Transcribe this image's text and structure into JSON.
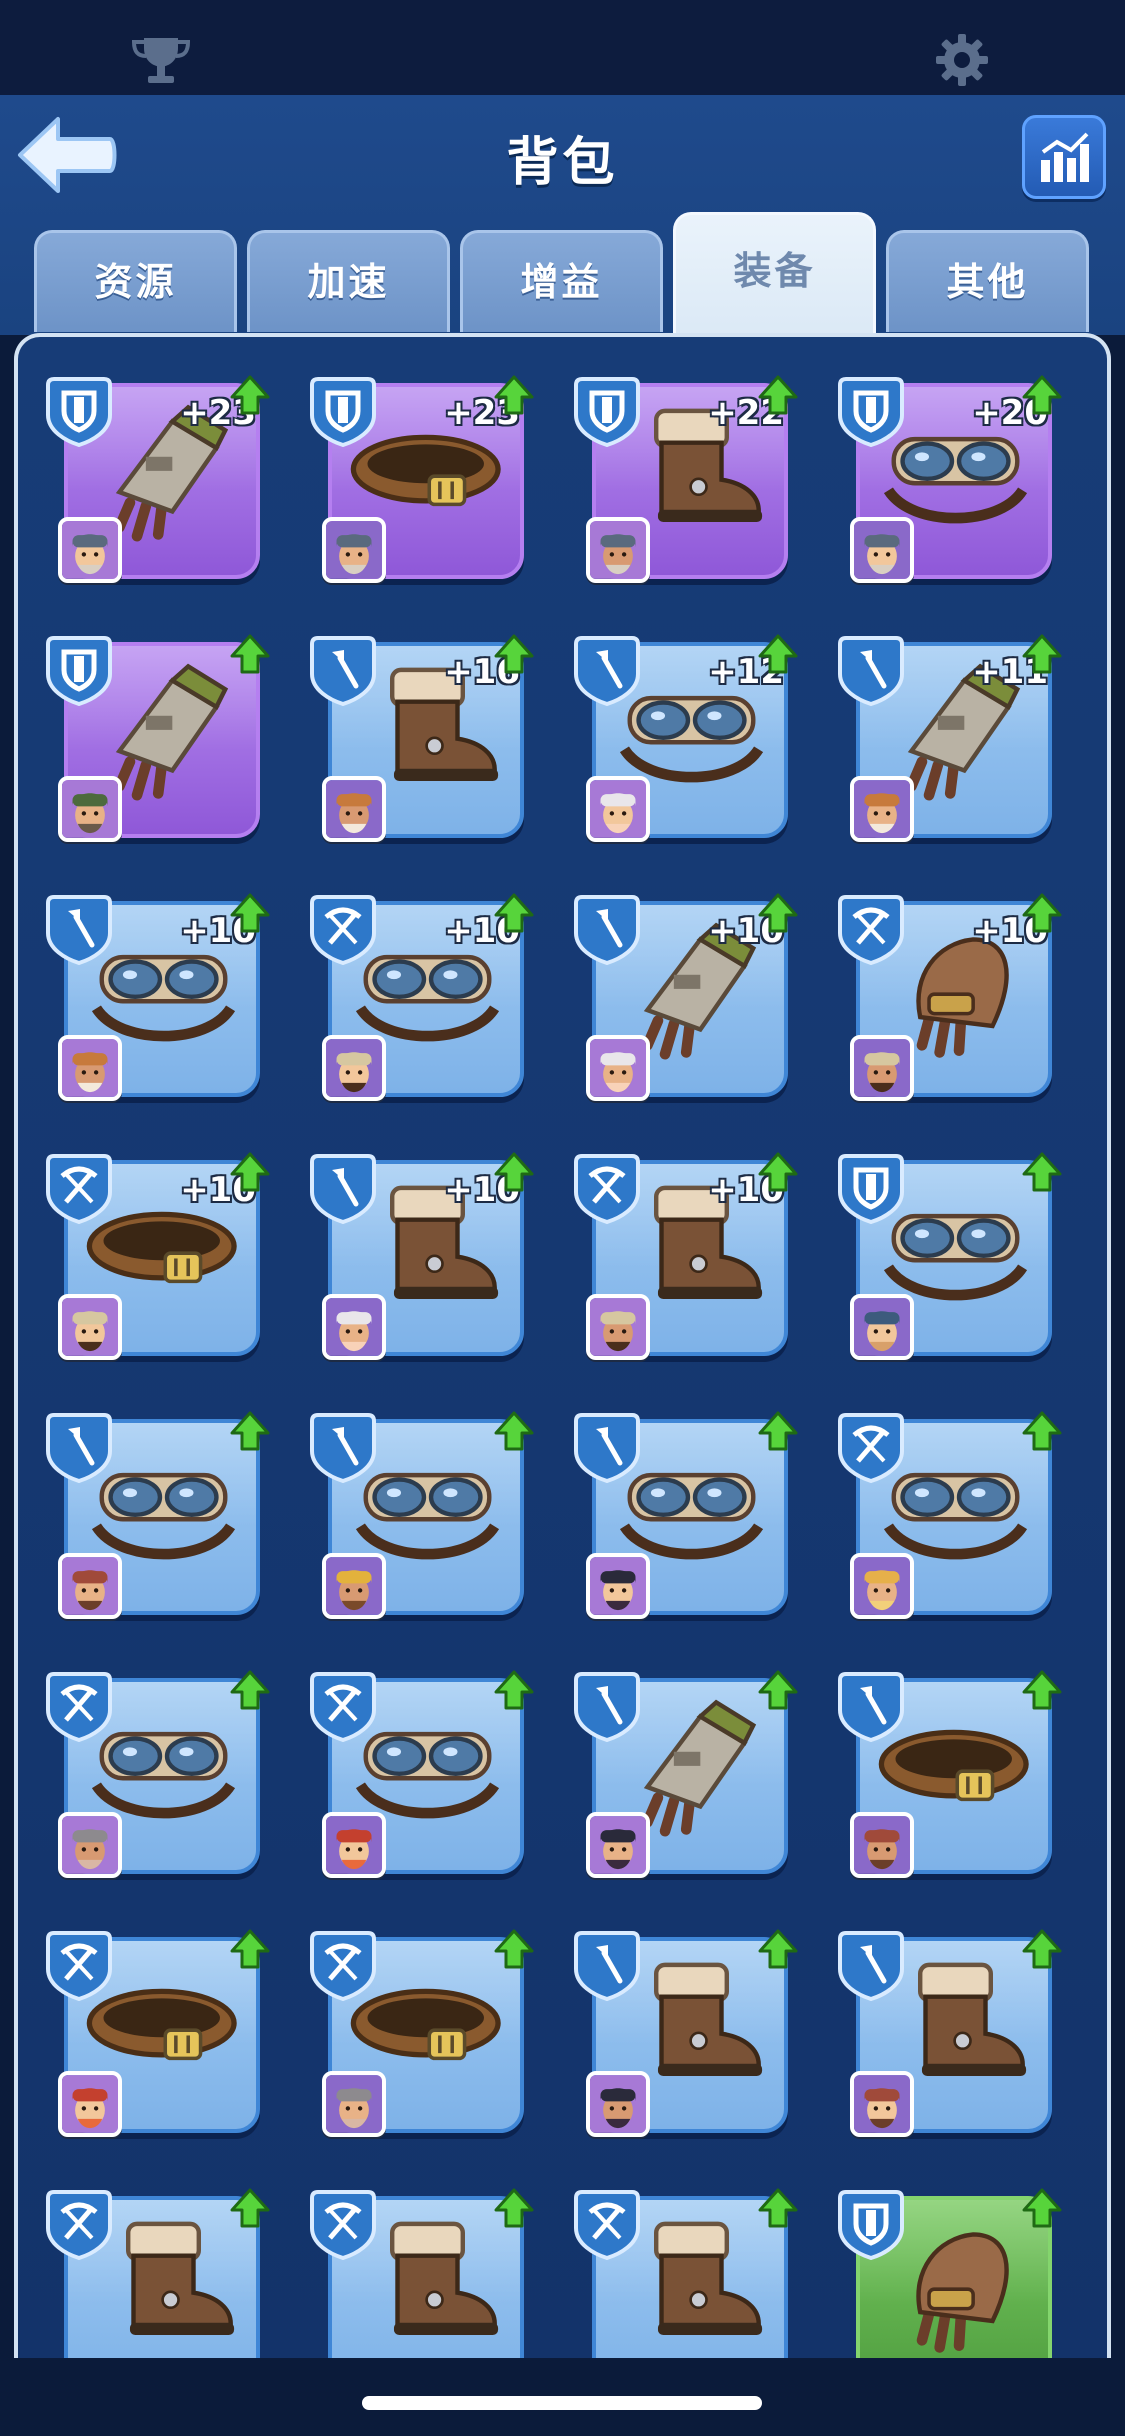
{
  "header": {
    "title": "背包"
  },
  "tabs": [
    {
      "label": "资源",
      "active": false
    },
    {
      "label": "加速",
      "active": false
    },
    {
      "label": "增益",
      "active": false
    },
    {
      "label": "装备",
      "active": true
    },
    {
      "label": "其他",
      "active": false
    }
  ],
  "icons": {
    "top_left": "trophy-icon",
    "top_right": "gear-icon",
    "back": "back-arrow-icon",
    "stats": "bar-chart-icon"
  },
  "colors": {
    "rarity_epic": "#9a63de",
    "rarity_rare": "#8fbfee",
    "rarity_uncommon": "#5aad47",
    "upgrade_arrow": "#57d43b"
  },
  "inventory": [
    {
      "rarity": "epic",
      "class": "shield",
      "item": "gauntlet",
      "plus": "+23",
      "upgrade": true,
      "hero": "hero-bearded-helmet"
    },
    {
      "rarity": "epic",
      "class": "shield",
      "item": "belt",
      "plus": "+23",
      "upgrade": true,
      "hero": "hero-bearded-helmet"
    },
    {
      "rarity": "epic",
      "class": "shield",
      "item": "boot",
      "plus": "+22",
      "upgrade": true,
      "hero": "hero-bearded-helmet"
    },
    {
      "rarity": "epic",
      "class": "shield",
      "item": "goggles",
      "plus": "+20",
      "upgrade": true,
      "hero": "hero-bearded-helmet"
    },
    {
      "rarity": "epic",
      "class": "shield",
      "item": "gauntlet",
      "plus": "",
      "upgrade": true,
      "hero": "hero-green-helmet"
    },
    {
      "rarity": "rare",
      "class": "shovel",
      "item": "boot",
      "plus": "+16",
      "upgrade": true,
      "hero": "hero-viking"
    },
    {
      "rarity": "rare",
      "class": "shovel",
      "item": "goggles",
      "plus": "+12",
      "upgrade": true,
      "hero": "hero-white-hair"
    },
    {
      "rarity": "rare",
      "class": "shovel",
      "item": "gauntlet",
      "plus": "+11",
      "upgrade": true,
      "hero": "hero-viking"
    },
    {
      "rarity": "rare",
      "class": "shovel",
      "item": "goggles",
      "plus": "+10",
      "upgrade": true,
      "hero": "hero-viking"
    },
    {
      "rarity": "rare",
      "class": "crossbow",
      "item": "goggles",
      "plus": "+10",
      "upgrade": true,
      "hero": "hero-desert"
    },
    {
      "rarity": "rare",
      "class": "shovel",
      "item": "gauntlet",
      "plus": "+10",
      "upgrade": true,
      "hero": "hero-white-hair"
    },
    {
      "rarity": "rare",
      "class": "crossbow",
      "item": "glove",
      "plus": "+10",
      "upgrade": true,
      "hero": "hero-desert"
    },
    {
      "rarity": "rare",
      "class": "crossbow",
      "item": "belt",
      "plus": "+10",
      "upgrade": true,
      "hero": "hero-desert"
    },
    {
      "rarity": "rare",
      "class": "shovel",
      "item": "boot",
      "plus": "+10",
      "upgrade": true,
      "hero": "hero-white-hair"
    },
    {
      "rarity": "rare",
      "class": "crossbow",
      "item": "boot",
      "plus": "+10",
      "upgrade": true,
      "hero": "hero-desert"
    },
    {
      "rarity": "rare",
      "class": "shield",
      "item": "goggles",
      "plus": "",
      "upgrade": true,
      "hero": "hero-diver"
    },
    {
      "rarity": "rare",
      "class": "shovel",
      "item": "goggles",
      "plus": "",
      "upgrade": true,
      "hero": "hero-bandana"
    },
    {
      "rarity": "rare",
      "class": "shovel",
      "item": "goggles",
      "plus": "",
      "upgrade": true,
      "hero": "hero-miner"
    },
    {
      "rarity": "rare",
      "class": "shovel",
      "item": "goggles",
      "plus": "",
      "upgrade": true,
      "hero": "hero-dark-hair"
    },
    {
      "rarity": "rare",
      "class": "crossbow",
      "item": "goggles",
      "plus": "",
      "upgrade": true,
      "hero": "hero-blonde"
    },
    {
      "rarity": "rare",
      "class": "crossbow",
      "item": "goggles",
      "plus": "",
      "upgrade": true,
      "hero": "hero-grey-hair"
    },
    {
      "rarity": "rare",
      "class": "crossbow",
      "item": "goggles",
      "plus": "",
      "upgrade": true,
      "hero": "hero-redhead"
    },
    {
      "rarity": "rare",
      "class": "shovel",
      "item": "gauntlet",
      "plus": "",
      "upgrade": true,
      "hero": "hero-dark-hair"
    },
    {
      "rarity": "rare",
      "class": "shovel",
      "item": "belt",
      "plus": "",
      "upgrade": true,
      "hero": "hero-bandana"
    },
    {
      "rarity": "rare",
      "class": "crossbow",
      "item": "belt",
      "plus": "",
      "upgrade": true,
      "hero": "hero-redhead"
    },
    {
      "rarity": "rare",
      "class": "crossbow",
      "item": "belt",
      "plus": "",
      "upgrade": true,
      "hero": "hero-grey-hair"
    },
    {
      "rarity": "rare",
      "class": "shovel",
      "item": "boot",
      "plus": "",
      "upgrade": true,
      "hero": "hero-dark-hair"
    },
    {
      "rarity": "rare",
      "class": "shovel",
      "item": "boot",
      "plus": "",
      "upgrade": true,
      "hero": "hero-bandana"
    },
    {
      "rarity": "rare",
      "class": "crossbow",
      "item": "boot",
      "plus": "",
      "upgrade": true,
      "hero": ""
    },
    {
      "rarity": "rare",
      "class": "crossbow",
      "item": "boot",
      "plus": "",
      "upgrade": true,
      "hero": ""
    },
    {
      "rarity": "rare",
      "class": "crossbow",
      "item": "boot",
      "plus": "",
      "upgrade": true,
      "hero": ""
    },
    {
      "rarity": "uncommon",
      "class": "shield",
      "item": "glove",
      "plus": "",
      "upgrade": true,
      "hero": ""
    }
  ]
}
